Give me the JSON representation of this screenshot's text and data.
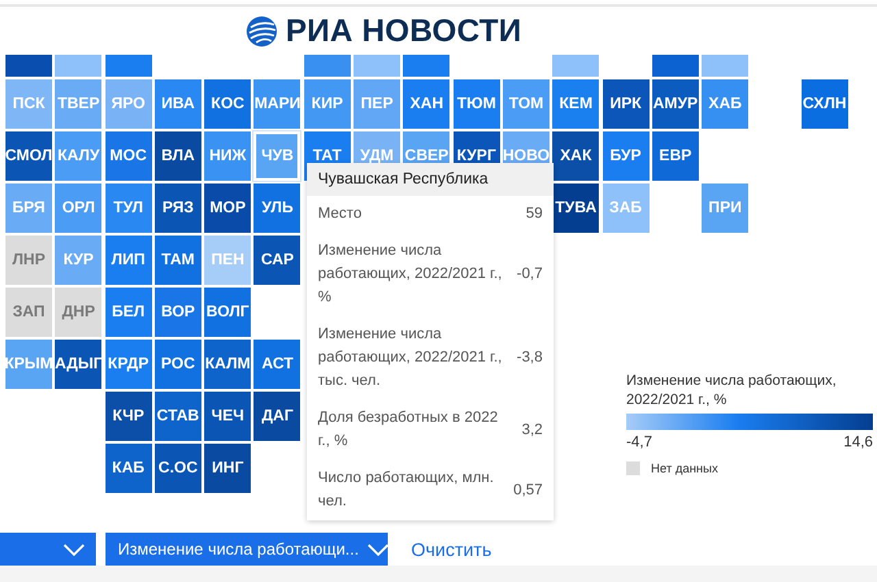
{
  "logo": {
    "text": "РИА НОВОСТИ"
  },
  "map": {
    "rows": [
      {
        "kind": "partial",
        "cells": [
          {
            "kind": "region",
            "color": "#0a4fb0"
          },
          {
            "kind": "region",
            "color": "#8ec0fa"
          },
          {
            "kind": "region",
            "color": "#1a7ef0"
          },
          {
            "kind": "empty"
          },
          {
            "kind": "empty"
          },
          {
            "kind": "empty"
          },
          {
            "kind": "region",
            "color": "#3a90f0"
          },
          {
            "kind": "region",
            "color": "#8ec0fa"
          },
          {
            "kind": "region",
            "color": "#1a7ef0"
          },
          {
            "kind": "empty"
          },
          {
            "kind": "empty"
          },
          {
            "kind": "region",
            "color": "#8ec0fa"
          },
          {
            "kind": "empty"
          },
          {
            "kind": "region",
            "color": "#0c62d0"
          },
          {
            "kind": "region",
            "color": "#8ec0fa"
          }
        ]
      },
      {
        "kind": "full",
        "cells": [
          {
            "kind": "region",
            "label": "ПСК",
            "color": "#7fb6f6"
          },
          {
            "kind": "region",
            "label": "ТВЕР",
            "color": "#6aabf5"
          },
          {
            "kind": "region",
            "label": "ЯРО",
            "color": "#7ab3f5"
          },
          {
            "kind": "region",
            "label": "ИВА",
            "color": "#2a88f2"
          },
          {
            "kind": "region",
            "label": "КОС",
            "color": "#1271e0"
          },
          {
            "kind": "region",
            "label": "МАРИ",
            "color": "#3d95f3"
          },
          {
            "kind": "region",
            "label": "КИР",
            "color": "#4398f3"
          },
          {
            "kind": "region",
            "label": "ПЕР",
            "color": "#62a7f5"
          },
          {
            "kind": "region",
            "label": "ХАН",
            "color": "#1a7ef0"
          },
          {
            "kind": "region",
            "label": "ТЮМ",
            "color": "#1a7ef0"
          },
          {
            "kind": "region",
            "label": "ТОМ",
            "color": "#4a9cf4"
          },
          {
            "kind": "region",
            "label": "КЕМ",
            "color": "#1a80f0"
          },
          {
            "kind": "region",
            "label": "ИРК",
            "color": "#0b56b8"
          },
          {
            "kind": "region",
            "label": "АМУР",
            "color": "#0c5cc0"
          },
          {
            "kind": "region",
            "label": "ХАБ",
            "color": "#3590f2"
          },
          {
            "kind": "empty"
          },
          {
            "kind": "region",
            "label": "СХЛН",
            "color": "#0a6ee0"
          }
        ]
      },
      {
        "kind": "full",
        "cells": [
          {
            "kind": "region",
            "label": "СМОЛ",
            "color": "#0b55b5"
          },
          {
            "kind": "region",
            "label": "КАЛУ",
            "color": "#4a9cf4"
          },
          {
            "kind": "region",
            "label": "МОС",
            "color": "#1a76e6"
          },
          {
            "kind": "region",
            "label": "ВЛА",
            "color": "#0a4aa0"
          },
          {
            "kind": "region",
            "label": "НИЖ",
            "color": "#3a92f2"
          },
          {
            "kind": "region",
            "label": "ЧУВ",
            "color": "#5aa4f4",
            "selected": true
          },
          {
            "kind": "region",
            "label": "ТАТ",
            "color": "#1a7ef0"
          },
          {
            "kind": "region",
            "label": "УДМ",
            "color": "#7ab3f5"
          },
          {
            "kind": "region",
            "label": "СВЕР",
            "color": "#5aa4f4"
          },
          {
            "kind": "region",
            "label": "КУРГ",
            "color": "#0b56b8"
          },
          {
            "kind": "region",
            "label": "НОВО",
            "color": "#6aabf5"
          },
          {
            "kind": "region",
            "label": "ХАК",
            "color": "#0b4fa8"
          },
          {
            "kind": "region",
            "label": "БУР",
            "color": "#1a7ef0"
          },
          {
            "kind": "region",
            "label": "ЕВР",
            "color": "#0f6ad8"
          }
        ]
      },
      {
        "kind": "full",
        "cells": [
          {
            "kind": "region",
            "label": "БРЯ",
            "color": "#6aabf5"
          },
          {
            "kind": "region",
            "label": "ОРЛ",
            "color": "#4a9cf4"
          },
          {
            "kind": "region",
            "label": "ТУЛ",
            "color": "#2a88f2"
          },
          {
            "kind": "region",
            "label": "РЯЗ",
            "color": "#0b55b5"
          },
          {
            "kind": "region",
            "label": "МОР",
            "color": "#0a4aa8"
          },
          {
            "kind": "region",
            "label": "УЛЬ",
            "color": "#1271e0"
          },
          {
            "kind": "empty"
          },
          {
            "kind": "empty"
          },
          {
            "kind": "empty"
          },
          {
            "kind": "empty"
          },
          {
            "kind": "empty"
          },
          {
            "kind": "region",
            "label": "ТУВА",
            "color": "#043e90"
          },
          {
            "kind": "region",
            "label": "ЗАБ",
            "color": "#8ec0fa"
          },
          {
            "kind": "empty"
          },
          {
            "kind": "region",
            "label": "ПРИ",
            "color": "#5aa4f4"
          }
        ]
      },
      {
        "kind": "full",
        "cells": [
          {
            "kind": "region",
            "label": "ЛНР",
            "color": "#dcdcdc"
          },
          {
            "kind": "region",
            "label": "КУР",
            "color": "#6aabf5"
          },
          {
            "kind": "region",
            "label": "ЛИП",
            "color": "#1a7ef0"
          },
          {
            "kind": "region",
            "label": "ТАМ",
            "color": "#1271e0"
          },
          {
            "kind": "region",
            "label": "ПЕН",
            "color": "#a6ccf8"
          },
          {
            "kind": "region",
            "label": "САР",
            "color": "#0b55b5"
          }
        ]
      },
      {
        "kind": "full",
        "cells": [
          {
            "kind": "region",
            "label": "ЗАП",
            "color": "#dcdcdc"
          },
          {
            "kind": "region",
            "label": "ДНР",
            "color": "#dcdcdc"
          },
          {
            "kind": "region",
            "label": "БЕЛ",
            "color": "#1a7ef0"
          },
          {
            "kind": "region",
            "label": "ВОР",
            "color": "#1a76e6"
          },
          {
            "kind": "region",
            "label": "ВОЛГ",
            "color": "#1271e0"
          }
        ]
      },
      {
        "kind": "full",
        "cells": [
          {
            "kind": "region",
            "label": "КРЫМ",
            "color": "#5aa4f4"
          },
          {
            "kind": "region",
            "label": "АДЫГ",
            "color": "#0b55b5"
          },
          {
            "kind": "region",
            "label": "КРДР",
            "color": "#1a7ef0"
          },
          {
            "kind": "region",
            "label": "РОС",
            "color": "#1271e0"
          },
          {
            "kind": "region",
            "label": "КАЛМ",
            "color": "#0f64cc"
          },
          {
            "kind": "region",
            "label": "АСТ",
            "color": "#1271e0"
          }
        ]
      },
      {
        "kind": "full",
        "cells": [
          {
            "kind": "empty"
          },
          {
            "kind": "empty"
          },
          {
            "kind": "region",
            "label": "КЧР",
            "color": "#0b4fa8"
          },
          {
            "kind": "region",
            "label": "СТАВ",
            "color": "#0f64cc"
          },
          {
            "kind": "region",
            "label": "ЧЕЧ",
            "color": "#0b55b5"
          },
          {
            "kind": "region",
            "label": "ДАГ",
            "color": "#0a4aa0"
          }
        ]
      },
      {
        "kind": "full",
        "cells": [
          {
            "kind": "empty"
          },
          {
            "kind": "empty"
          },
          {
            "kind": "region",
            "label": "КАБ",
            "color": "#0f64cc"
          },
          {
            "kind": "region",
            "label": "С.ОС",
            "color": "#0b55b5"
          },
          {
            "kind": "region",
            "label": "ИНГ",
            "color": "#0a4aa0"
          }
        ]
      }
    ]
  },
  "tooltip": {
    "title": "Чувашская Республика",
    "rows": [
      {
        "label": "Место",
        "value": "59"
      },
      {
        "label": "Изменение числа работающих, 2022/2021 г., %",
        "value": "-0,7"
      },
      {
        "label": "Изменение числа работающих, 2022/2021 г., тыс. чел.",
        "value": "-3,8"
      },
      {
        "label": "Доля безработных в 2022 г., %",
        "value": "3,2"
      },
      {
        "label": "Число работающих, млн. чел.",
        "value": "0,57"
      }
    ]
  },
  "legend": {
    "title": "Изменение числа работающих, 2022/2021 г., %",
    "min": "-4,7",
    "max": "14,6",
    "no_data": "Нет данных"
  },
  "controls": {
    "dropdowns": [
      {
        "kind": "icon_only"
      },
      {
        "kind": "labeled",
        "value": "Изменение числа работающи..."
      }
    ],
    "clear_link": "Очистить"
  }
}
